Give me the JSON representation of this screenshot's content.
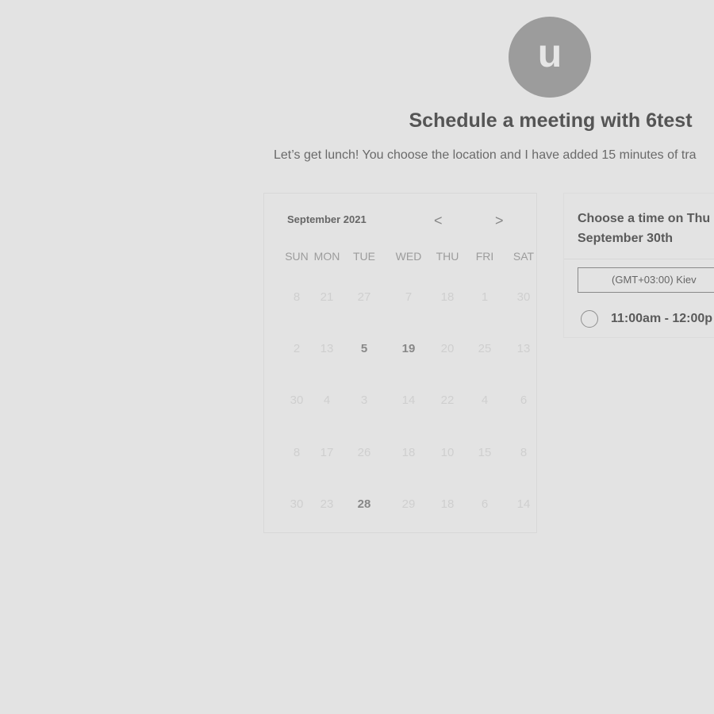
{
  "host": {
    "avatar_initial": "u",
    "title": "Schedule a meeting with 6test",
    "subtitle": "Let’s get lunch! You choose the location and I have added 15 minutes of tra"
  },
  "calendar": {
    "month_label": "September 2021",
    "prev_glyph": "<",
    "next_glyph": ">",
    "weekdays": [
      "SUN",
      "MON",
      "TUE",
      "WED",
      "THU",
      "FRI",
      "SAT"
    ],
    "weeks": [
      [
        {
          "d": "8",
          "a": false
        },
        {
          "d": "21",
          "a": false
        },
        {
          "d": "27",
          "a": false
        },
        {
          "d": "7",
          "a": false
        },
        {
          "d": "18",
          "a": false
        },
        {
          "d": "1",
          "a": false
        },
        {
          "d": "30",
          "a": false
        }
      ],
      [
        {
          "d": "2",
          "a": false
        },
        {
          "d": "13",
          "a": false
        },
        {
          "d": "5",
          "a": true
        },
        {
          "d": "19",
          "a": true
        },
        {
          "d": "20",
          "a": false
        },
        {
          "d": "25",
          "a": false
        },
        {
          "d": "13",
          "a": false
        }
      ],
      [
        {
          "d": "30",
          "a": false
        },
        {
          "d": "4",
          "a": false
        },
        {
          "d": "3",
          "a": false
        },
        {
          "d": "14",
          "a": false
        },
        {
          "d": "22",
          "a": false
        },
        {
          "d": "4",
          "a": false
        },
        {
          "d": "6",
          "a": false
        }
      ],
      [
        {
          "d": "8",
          "a": false
        },
        {
          "d": "17",
          "a": false
        },
        {
          "d": "26",
          "a": false
        },
        {
          "d": "18",
          "a": false
        },
        {
          "d": "10",
          "a": false
        },
        {
          "d": "15",
          "a": false
        },
        {
          "d": "8",
          "a": false
        }
      ],
      [
        {
          "d": "30",
          "a": false
        },
        {
          "d": "23",
          "a": false
        },
        {
          "d": "28",
          "a": true
        },
        {
          "d": "29",
          "a": false
        },
        {
          "d": "18",
          "a": false
        },
        {
          "d": "6",
          "a": false
        },
        {
          "d": "14",
          "a": false
        }
      ]
    ]
  },
  "times": {
    "heading_line1": "Choose a time on Thu",
    "heading_line2": "September 30th",
    "timezone": "(GMT+03:00) Kiev",
    "slots": [
      {
        "label": "11:00am - 12:00p"
      }
    ]
  }
}
